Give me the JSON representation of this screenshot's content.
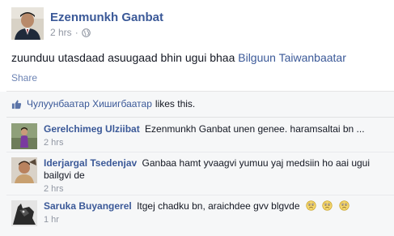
{
  "post": {
    "author": "Ezenmunkh Ganbat",
    "time": "2 hrs",
    "separator": "·",
    "audience_icon": "globe-icon",
    "text": "zuunduu utasdaad asuugaad bhin ugui bhaa",
    "tagged": "Bilguun Taiwanbaatar",
    "share_label": "Share"
  },
  "likes": {
    "icon": "thumbs-up-icon",
    "liker": "Чулуунбаатар Хишигбаатар",
    "suffix": "likes this."
  },
  "comments": [
    {
      "author": "Gerelchimeg Ulziibat",
      "text": "Ezenmunkh Ganbat unen genee. haramsaltai bn ...",
      "time": "2 hrs"
    },
    {
      "author": "Iderjargal Tsedenjav",
      "text": "Ganbaa hamt yvaagvi yumuu yaj medsiin ho aai ugui bailgvi de",
      "time": "2 hrs"
    },
    {
      "author": "Saruka Buyangerel",
      "text": "Itgej chadku bn, araichdee gvv blgvde",
      "time": "1 hr",
      "emoji": [
        "confused-face-icon",
        "confused-face-icon",
        "confused-face-icon"
      ]
    }
  ],
  "colors": {
    "link": "#3b5998",
    "meta": "#9197a3",
    "feedback_bg": "#f6f7f8",
    "text": "#141823"
  }
}
